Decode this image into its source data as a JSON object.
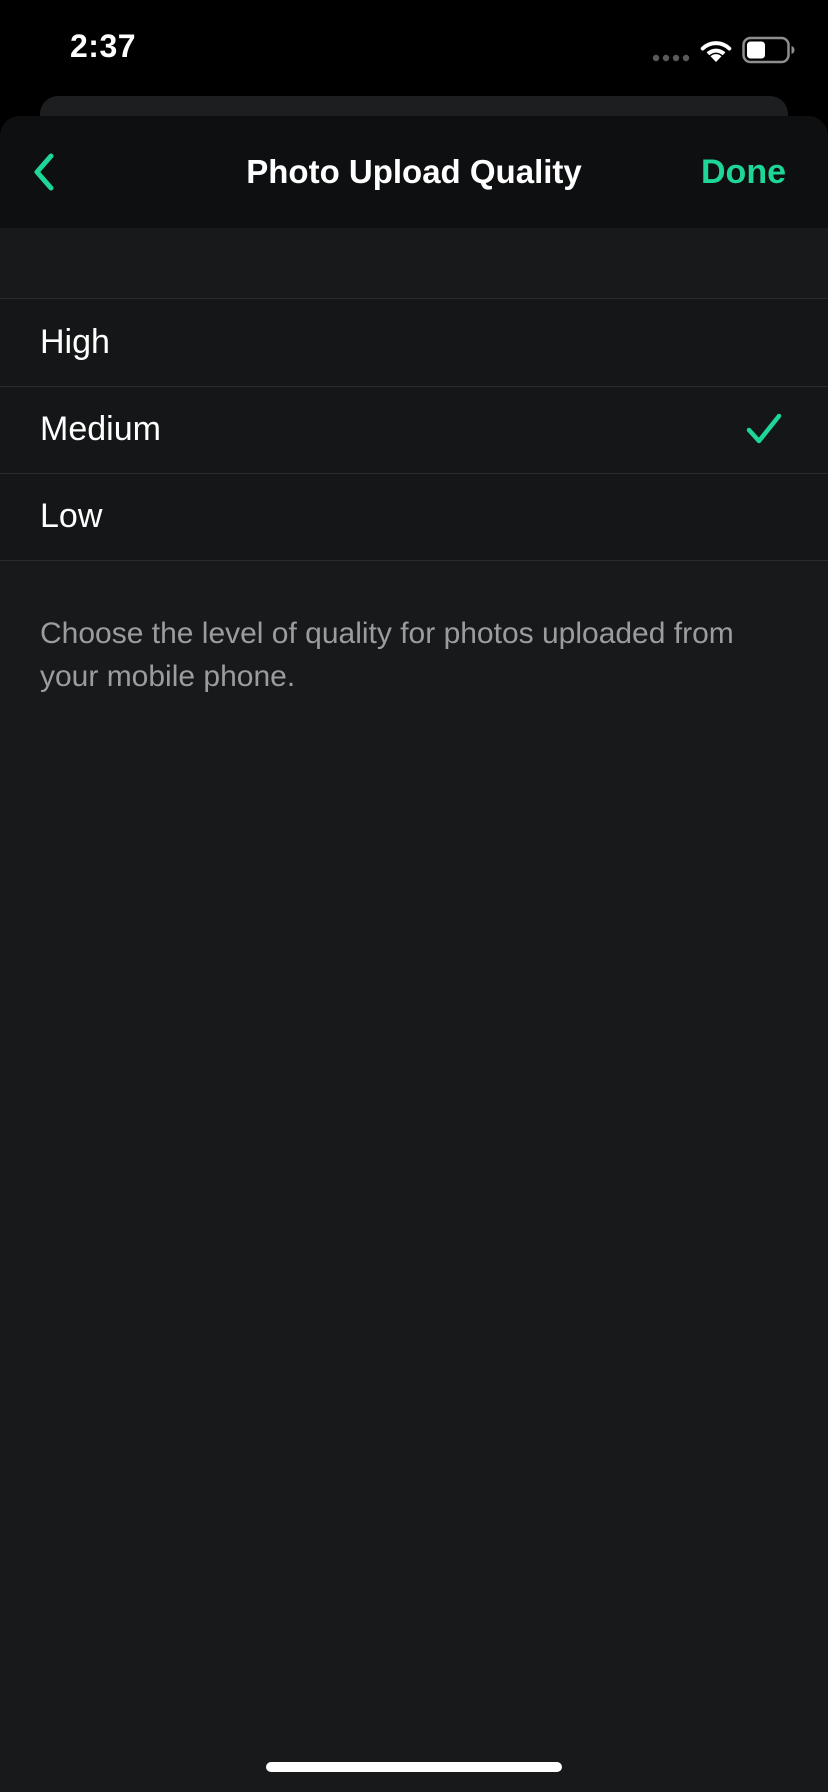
{
  "status_bar": {
    "time": "2:37",
    "icons": [
      "cellular-signal-icon",
      "wifi-icon",
      "battery-icon"
    ]
  },
  "nav": {
    "back_icon": "chevron-left-icon",
    "title": "Photo Upload Quality",
    "done_label": "Done"
  },
  "options": [
    {
      "label": "High",
      "selected": false
    },
    {
      "label": "Medium",
      "selected": true
    },
    {
      "label": "Low",
      "selected": false
    }
  ],
  "footer": {
    "description": "Choose the level of quality for photos uploaded from your mobile phone."
  },
  "colors": {
    "accent": "#1ed697",
    "background": "#17191a",
    "nav_background": "#0d0f11",
    "list_background": "#141617",
    "secondary_text": "#9a9d9f"
  }
}
